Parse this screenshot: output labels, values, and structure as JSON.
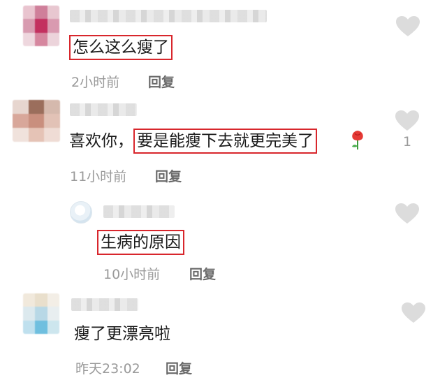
{
  "colors": {
    "highlight_border": "#d8262c",
    "meta_text": "#9a9a9a",
    "reply_text": "#6a6a6a",
    "heart": "#dcdcdc"
  },
  "comments": [
    {
      "text_plain": "",
      "text_highlight": "怎么这么瘦了",
      "text_suffix": "",
      "time": "2小时前",
      "reply_label": "回复",
      "like_count": "",
      "avatar_colors": [
        "#e9c4cf",
        "#cf7f9a",
        "#e8c7d0",
        "#d89bb0",
        "#c3305f",
        "#d99ab0",
        "#eed7de",
        "#d6879f",
        "#ecd4db"
      ]
    },
    {
      "text_plain": "喜欢你，",
      "text_highlight": "要是能瘦下去就更完美了",
      "text_suffix": "",
      "icon": "rose-icon",
      "time": "11小时前",
      "reply_label": "回复",
      "like_count": "1",
      "avatar_colors": [
        "#e7d6cf",
        "#9b6e5c",
        "#d5b9ad",
        "#d8a79a",
        "#c98f7e",
        "#e2c2b6",
        "#f0e2dc",
        "#e5c3b6",
        "#efdcd5"
      ]
    },
    {
      "text_plain": "",
      "text_highlight": "生病的原因",
      "text_suffix": "",
      "time": "10小时前",
      "reply_label": "回复",
      "like_count": "",
      "is_reply": true
    },
    {
      "text_plain": "瘦了更漂亮啦",
      "text_highlight": "",
      "text_suffix": "",
      "time": "昨天23:02",
      "reply_label": "回复",
      "like_count": "",
      "avatar_colors": [
        "#f1e9dc",
        "#e9dfcc",
        "#f3eee6",
        "#dce9ee",
        "#b8d8e6",
        "#e8eef0",
        "#bfe0ee",
        "#6fbfdf",
        "#cde6ee"
      ]
    }
  ]
}
